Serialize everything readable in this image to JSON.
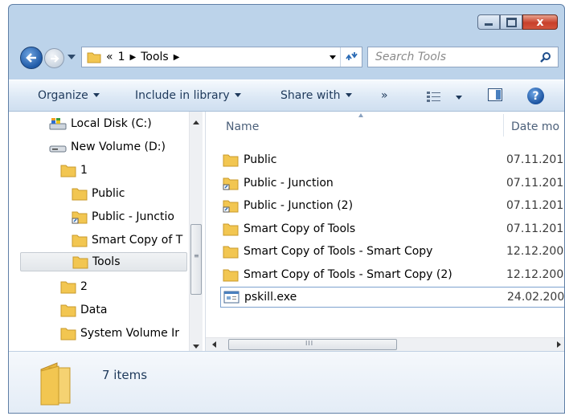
{
  "window": {
    "caption_close": "x"
  },
  "address_bar": {
    "overflow": "«",
    "crumbs": [
      "1",
      "Tools"
    ]
  },
  "search": {
    "placeholder": "Search Tools"
  },
  "toolbar": {
    "organize": "Organize",
    "include_in_library": "Include in library",
    "share_with": "Share with",
    "more": "»"
  },
  "nav_tree": [
    {
      "label": "Local Disk (C:)",
      "icon": "drive-icon"
    },
    {
      "label": "New Volume (D:)",
      "icon": "drive-icon"
    },
    {
      "label": "1",
      "icon": "folder-icon"
    },
    {
      "label": "Public",
      "icon": "folder-icon"
    },
    {
      "label": "Public - Junctio",
      "icon": "junction-folder-icon"
    },
    {
      "label": "Smart Copy of T",
      "icon": "folder-icon"
    },
    {
      "label": "Tools",
      "icon": "folder-icon",
      "selected": true
    },
    {
      "label": "2",
      "icon": "folder-icon"
    },
    {
      "label": "Data",
      "icon": "folder-icon"
    },
    {
      "label": "System Volume Ir",
      "icon": "folder-icon"
    }
  ],
  "columns": {
    "name": "Name",
    "date": "Date mo"
  },
  "files": [
    {
      "name": "Public",
      "date": "07.11.201",
      "icon": "folder-icon"
    },
    {
      "name": "Public - Junction",
      "date": "07.11.201",
      "icon": "junction-folder-icon"
    },
    {
      "name": "Public - Junction (2)",
      "date": "07.11.201",
      "icon": "junction-folder-icon"
    },
    {
      "name": "Smart Copy of Tools",
      "date": "07.11.201",
      "icon": "folder-icon"
    },
    {
      "name": "Smart Copy of Tools - Smart Copy",
      "date": "12.12.200",
      "icon": "folder-icon"
    },
    {
      "name": "Smart Copy of Tools - Smart Copy (2)",
      "date": "12.12.200",
      "icon": "folder-icon"
    },
    {
      "name": "pskill.exe",
      "date": "24.02.200",
      "icon": "exe-icon",
      "focused": true
    }
  ],
  "horizontal_scroll_grip": "III",
  "details": {
    "item_count": "7 items"
  },
  "colors": {
    "window_frame": "#bcd3ea",
    "folder": "#f2c651",
    "close_button": "#c8402b",
    "accent_blue": "#1f5aa7"
  }
}
